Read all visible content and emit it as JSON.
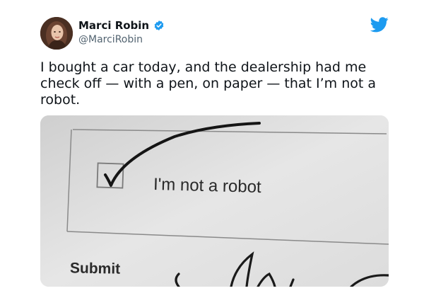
{
  "user": {
    "display_name": "Marci Robin",
    "handle": "@MarciRobin"
  },
  "icons": {
    "verified": "verified-badge-icon",
    "bird": "twitter-bird-icon"
  },
  "colors": {
    "twitter_blue": "#1d9bf0",
    "handle_gray": "#536471"
  },
  "tweet": {
    "text": "I bought a car today, and the dealership had me\ncheck off — with a pen, on paper — that I’m not a\nrobot."
  },
  "photo": {
    "checkbox_label": "I'm not a robot",
    "submit_label": "Submit"
  }
}
